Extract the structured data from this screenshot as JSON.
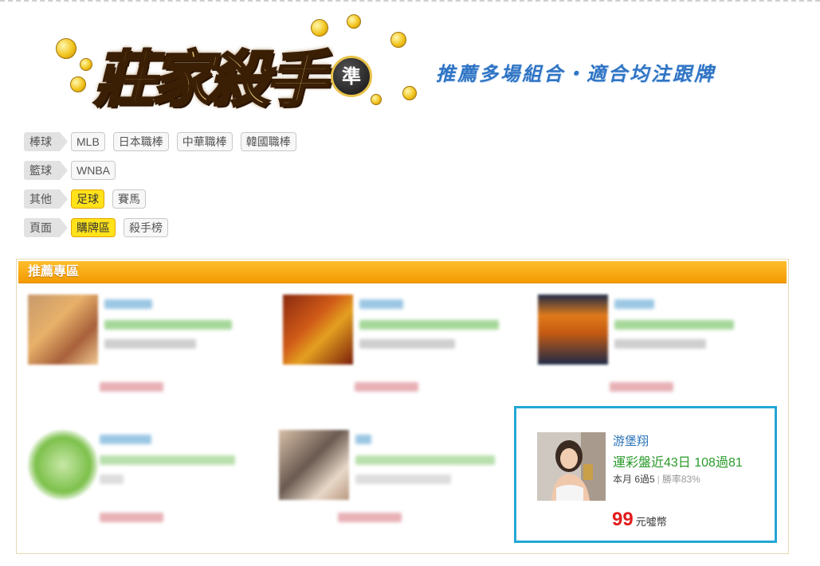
{
  "banner": {
    "logo": "莊家殺手",
    "badge": "準",
    "slogan": "推薦多場組合・適合均注跟牌"
  },
  "filters": [
    {
      "category": "棒球",
      "tags": [
        {
          "label": "MLB",
          "active": false
        },
        {
          "label": "日本職棒",
          "active": false
        },
        {
          "label": "中華職棒",
          "active": false
        },
        {
          "label": "韓國職棒",
          "active": false
        }
      ]
    },
    {
      "category": "籃球",
      "tags": [
        {
          "label": "WNBA",
          "active": false
        }
      ]
    },
    {
      "category": "其他",
      "tags": [
        {
          "label": "足球",
          "active": true
        },
        {
          "label": "賽馬",
          "active": false
        }
      ]
    },
    {
      "category": "頁面",
      "tags": [
        {
          "label": "購牌區",
          "active": true
        },
        {
          "label": "殺手榜",
          "active": false
        }
      ]
    }
  ],
  "panel": {
    "title": "推薦專區"
  },
  "featured": {
    "name": "游堡翔",
    "record": "運彩盤近43日 108過81",
    "month": "本月 6過5",
    "win_rate": "勝率83%",
    "price": "99",
    "price_unit": "元噓幣"
  },
  "colors": {
    "accent_orange": "#f39a00",
    "active_tag": "#ffe21a",
    "featured_border": "#22a7d5",
    "name_blue": "#2b73b8",
    "record_green": "#2a9a2a",
    "price_red": "#e21b1b"
  }
}
